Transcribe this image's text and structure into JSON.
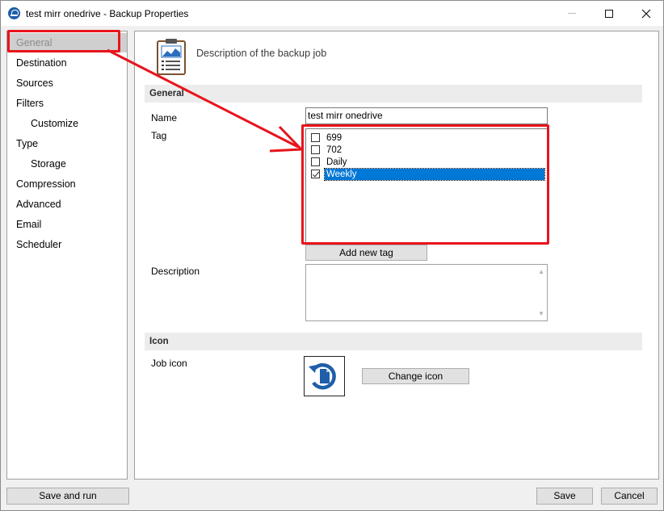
{
  "window": {
    "title": "test mirr onedrive - Backup Properties"
  },
  "nav": {
    "items": [
      {
        "label": "General",
        "selected": true,
        "sub": false
      },
      {
        "label": "Destination",
        "selected": false,
        "sub": false
      },
      {
        "label": "Sources",
        "selected": false,
        "sub": false
      },
      {
        "label": "Filters",
        "selected": false,
        "sub": false
      },
      {
        "label": "Customize",
        "selected": false,
        "sub": true
      },
      {
        "label": "Type",
        "selected": false,
        "sub": false
      },
      {
        "label": "Storage",
        "selected": false,
        "sub": true
      },
      {
        "label": "Compression",
        "selected": false,
        "sub": false
      },
      {
        "label": "Advanced",
        "selected": false,
        "sub": false
      },
      {
        "label": "Email",
        "selected": false,
        "sub": false
      },
      {
        "label": "Scheduler",
        "selected": false,
        "sub": false
      }
    ]
  },
  "header": {
    "description": "Description of the backup job"
  },
  "general": {
    "section_title": "General",
    "name_label": "Name",
    "name_value": "test mirr onedrive",
    "tag_label": "Tag",
    "tags": [
      {
        "label": "699",
        "checked": false,
        "selected": false
      },
      {
        "label": "702",
        "checked": false,
        "selected": false
      },
      {
        "label": "Daily",
        "checked": false,
        "selected": false
      },
      {
        "label": "Weekly",
        "checked": true,
        "selected": true
      }
    ],
    "add_tag_label": "Add new tag",
    "description_label": "Description",
    "description_value": ""
  },
  "icon_section": {
    "section_title": "Icon",
    "job_icon_label": "Job icon",
    "change_icon_label": "Change icon"
  },
  "footer": {
    "save_and_run_label": "Save and run",
    "save_label": "Save",
    "cancel_label": "Cancel"
  },
  "colors": {
    "accent": "#0078d7",
    "annotation": "#e8141c",
    "brand_blue": "#1f5ea8"
  }
}
